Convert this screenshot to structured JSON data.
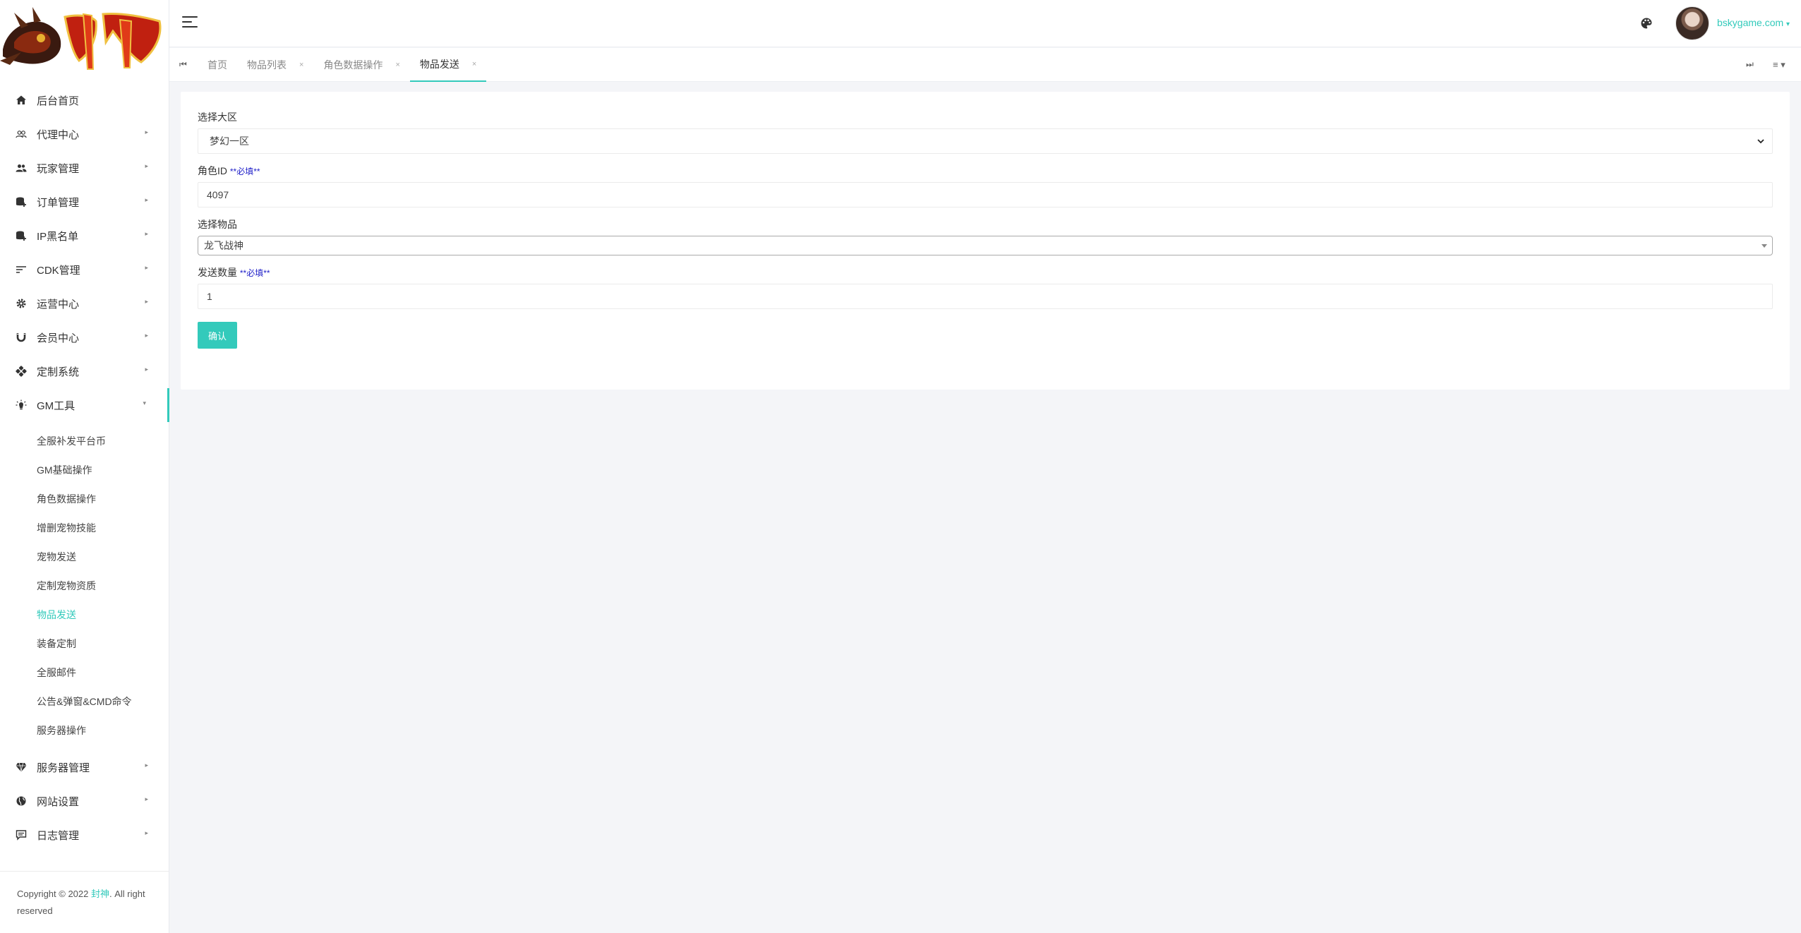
{
  "brand": {
    "logo_text": "封神"
  },
  "sidebar": {
    "items": [
      {
        "label": "后台首页",
        "icon": "home-icon",
        "has_children": false
      },
      {
        "label": "代理中心",
        "icon": "users-outline-icon",
        "has_children": true
      },
      {
        "label": "玩家管理",
        "icon": "users-icon",
        "has_children": true
      },
      {
        "label": "订单管理",
        "icon": "database-plus-icon",
        "has_children": true
      },
      {
        "label": "IP黑名单",
        "icon": "database-plus-icon",
        "has_children": true
      },
      {
        "label": "CDK管理",
        "icon": "sort-lines-icon",
        "has_children": true
      },
      {
        "label": "运营中心",
        "icon": "gear-icon",
        "has_children": true
      },
      {
        "label": "会员中心",
        "icon": "magnet-icon",
        "has_children": true
      },
      {
        "label": "定制系统",
        "icon": "gamepad-icon",
        "has_children": true
      },
      {
        "label": "GM工具",
        "icon": "lightbulb-icon",
        "has_children": true,
        "open": true
      }
    ],
    "gm_submenu": [
      "全服补发平台币",
      "GM基础操作",
      "角色数据操作",
      "增删宠物技能",
      "宠物发送",
      "定制宠物资质",
      "物品发送",
      "装备定制",
      "全服邮件",
      "公告&弹窗&CMD命令",
      "服务器操作"
    ],
    "active_sub": "物品发送",
    "items_after": [
      {
        "label": "服务器管理",
        "icon": "diamond-icon",
        "has_children": true
      },
      {
        "label": "网站设置",
        "icon": "globe-icon",
        "has_children": true
      },
      {
        "label": "日志管理",
        "icon": "comment-icon",
        "has_children": true
      }
    ],
    "copyright_prefix": "Copyright © 2022 ",
    "copyright_brand": "封神",
    "copyright_suffix": ". All right reserved"
  },
  "header": {
    "username": "bskygame.com"
  },
  "tabs": [
    {
      "label": "首页",
      "closable": false,
      "active": false
    },
    {
      "label": "物品列表",
      "closable": true,
      "active": false
    },
    {
      "label": "角色数据操作",
      "closable": true,
      "active": false
    },
    {
      "label": "物品发送",
      "closable": true,
      "active": true
    }
  ],
  "form": {
    "region_label": "选择大区",
    "region_value": "梦幻一区",
    "role_label": "角色ID",
    "role_required": "**必填**",
    "role_value": "4097",
    "item_label": "选择物品",
    "item_value": "龙飞战神",
    "qty_label": "发送数量",
    "qty_required": "**必填**",
    "qty_value": "1",
    "submit_label": "确认"
  },
  "colors": {
    "accent": "#33cabb",
    "required": "#1e1ec8"
  }
}
